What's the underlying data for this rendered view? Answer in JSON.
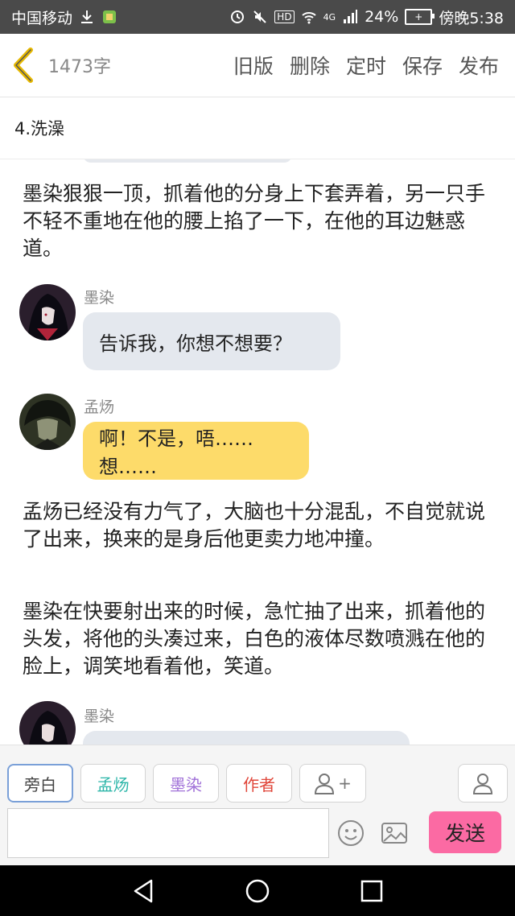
{
  "status_bar": {
    "carrier": "中国移动",
    "battery_percent": "24%",
    "time": "傍晚5:38",
    "network_label": "4G",
    "hd_label": "HD"
  },
  "header": {
    "word_count": "1473字",
    "actions": [
      "旧版",
      "删除",
      "定时",
      "保存",
      "发布"
    ]
  },
  "chapter": {
    "title": "4.洗澡"
  },
  "content": {
    "narration_1": "墨染狠狠一顶，抓着他的分身上下套弄着，另一只手不轻不重地在他的腰上掐了一下，在他的耳边魅惑道。",
    "msg_1": {
      "name": "墨染",
      "text": "告诉我，你想不想要？"
    },
    "msg_2": {
      "name": "孟炀",
      "text": "啊！不是，唔……想……"
    },
    "narration_2": "孟炀已经没有力气了，大脑也十分混乱，不自觉就说了出来，换来的是身后他更卖力地冲撞。",
    "narration_3": "墨染在快要射出来的时候，急忙抽了出来，抓着他的头发，将他的头凑过来，白色的液体尽数喷溅在他的脸上，调笑地看着他，笑道。",
    "msg_3": {
      "name": "墨染"
    }
  },
  "toolbar": {
    "chips": [
      {
        "label": "旁白",
        "color": "#333333"
      },
      {
        "label": "孟炀",
        "color": "#2bb5a8"
      },
      {
        "label": "墨染",
        "color": "#a070d8"
      },
      {
        "label": "作者",
        "color": "#e0463a"
      }
    ],
    "add_label": "+",
    "send_label": "发送",
    "input_value": ""
  },
  "colors": {
    "status_bg": "#4a4a4a",
    "bubble_blue": "#e4e8ee",
    "bubble_yellow": "#fddb6a",
    "send_bg": "#fb6aa3",
    "back_chevron": "#e6b800"
  }
}
